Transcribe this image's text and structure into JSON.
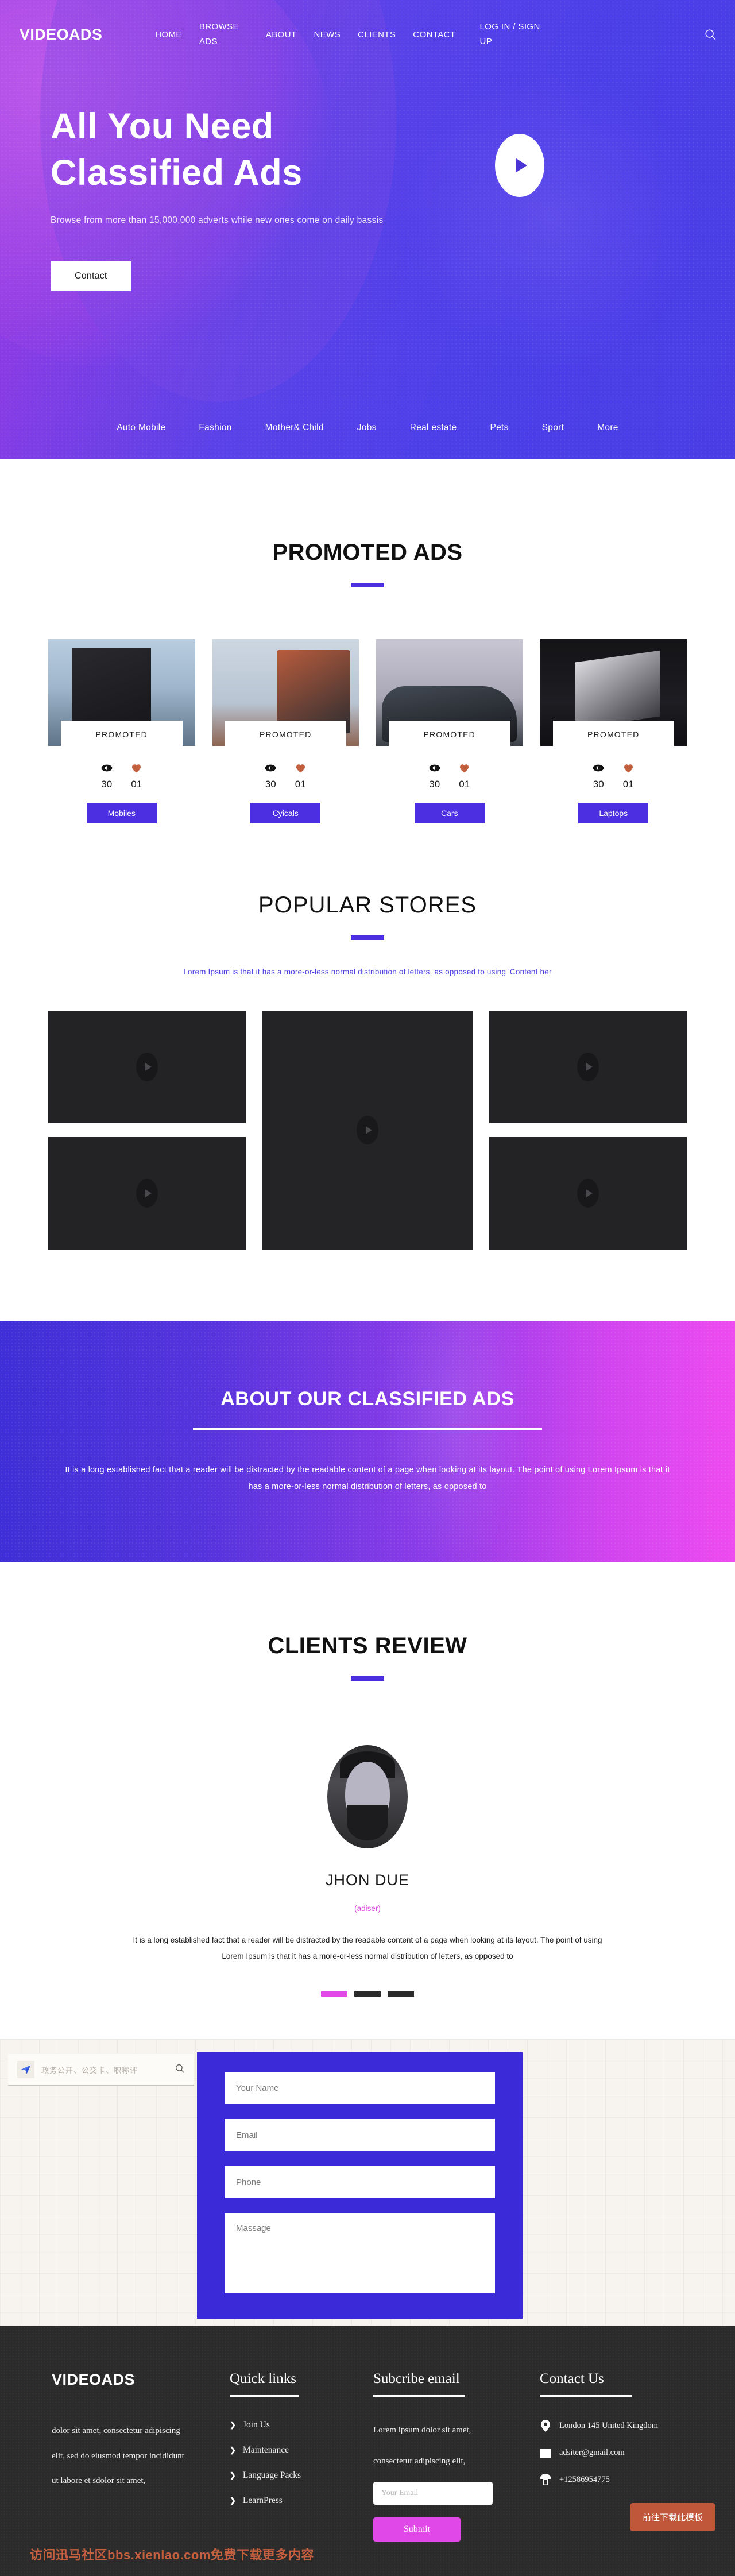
{
  "header": {
    "brand": "VIDEOADS",
    "nav": [
      {
        "label": "HOME"
      },
      {
        "label": "BROWSE ADS"
      },
      {
        "label": "ABOUT"
      },
      {
        "label": "NEWS"
      },
      {
        "label": "CLIENTS"
      },
      {
        "label": "CONTACT"
      },
      {
        "label": "LOG IN / SIGN UP"
      }
    ],
    "search_icon": "search-icon"
  },
  "hero": {
    "title_line1": "All You Need",
    "title_line2": "Classified Ads",
    "subtitle": "Browse from more than 15,000,000 adverts while new ones come on daily bassis",
    "cta": "Contact",
    "play_icon": "play-icon"
  },
  "categories": [
    {
      "label": "Auto Mobile"
    },
    {
      "label": "Fashion"
    },
    {
      "label": "Mother& Child"
    },
    {
      "label": "Jobs"
    },
    {
      "label": "Real estate"
    },
    {
      "label": "Pets"
    },
    {
      "label": "Sport"
    },
    {
      "label": "More"
    }
  ],
  "promoted": {
    "title": "PROMOTED ADS",
    "cards": [
      {
        "badge": "PROMOTED",
        "views": "30",
        "likes": "01",
        "cta": "Mobiles",
        "thumb": "ph-mobiles"
      },
      {
        "badge": "PROMOTED",
        "views": "30",
        "likes": "01",
        "cta": "Cyicals",
        "thumb": "ph-cycles"
      },
      {
        "badge": "PROMOTED",
        "views": "30",
        "likes": "01",
        "cta": "Cars",
        "thumb": "ph-cars"
      },
      {
        "badge": "PROMOTED",
        "views": "30",
        "likes": "01",
        "cta": "Laptops",
        "thumb": "ph-laptops"
      }
    ]
  },
  "stores": {
    "title": "POPULAR STORES",
    "description": "Lorem Ipsum is that it has a more-or-less normal distribution of letters, as opposed to using 'Content her",
    "tiles": [
      {
        "name": "store-tile-1"
      },
      {
        "name": "store-tile-2"
      },
      {
        "name": "store-tile-3"
      },
      {
        "name": "store-tile-4"
      },
      {
        "name": "store-tile-5"
      }
    ]
  },
  "about": {
    "title": "ABOUT OUR CLASSIFIED ADS",
    "text": "It is a long established fact that a reader will be distracted by the readable content of a page when looking at its layout. The point of using Lorem Ipsum is that it has a more-or-less normal distribution of letters, as opposed to"
  },
  "reviews": {
    "title": "CLIENTS REVIEW",
    "name": "JHON DUE",
    "role": "(adiser)",
    "text": "It is a long established fact that a reader will be distracted by the readable content of a page when looking at its layout. The point of using Lorem Ipsum is that it has a more-or-less normal distribution of letters, as opposed to",
    "dots": [
      {
        "active": true
      },
      {
        "active": false
      },
      {
        "active": false
      }
    ]
  },
  "search_widget": {
    "placeholder": "政务公开、公交卡、职称评",
    "logo_icon": "paper-plane-icon",
    "search_icon": "search-icon"
  },
  "contact_form": {
    "name_placeholder": "Your Name",
    "email_placeholder": "Email",
    "phone_placeholder": "Phone",
    "message_placeholder": "Massage"
  },
  "footer": {
    "brand": "VIDEOADS",
    "about_lines": [
      "dolor sit amet, consectetur adipiscing",
      "elit, sed do eiusmod tempor incididunt",
      "ut labore et sdolor sit amet,"
    ],
    "quick_links": {
      "title": "Quick links",
      "items": [
        {
          "label": "Join Us"
        },
        {
          "label": "Maintenance"
        },
        {
          "label": "Language Packs"
        },
        {
          "label": "LearnPress"
        }
      ]
    },
    "subscribe": {
      "title": "Subcribe email",
      "text_line1": "Lorem ipsum dolor sit amet,",
      "text_line2": "consectetur adipiscing elit,",
      "input_placeholder": "Your Email",
      "button": "Submit"
    },
    "contact": {
      "title": "Contact Us",
      "rows": [
        {
          "icon": "location-pin-icon",
          "value": "London 145 United Kingdom"
        },
        {
          "icon": "envelope-icon",
          "value": "adsiter@gmail.com"
        },
        {
          "icon": "phone-icon",
          "value": "+12586954775"
        }
      ]
    },
    "watermark": "访问迅马社区bbs.xienlao.com免费下载更多内容",
    "download_button": "前往下载此模板"
  },
  "colors": {
    "primary": "#4b2fe0",
    "accent_pink": "#e048e8",
    "hero_purple": "#a03ce0",
    "dark": "#2b2b2b"
  }
}
